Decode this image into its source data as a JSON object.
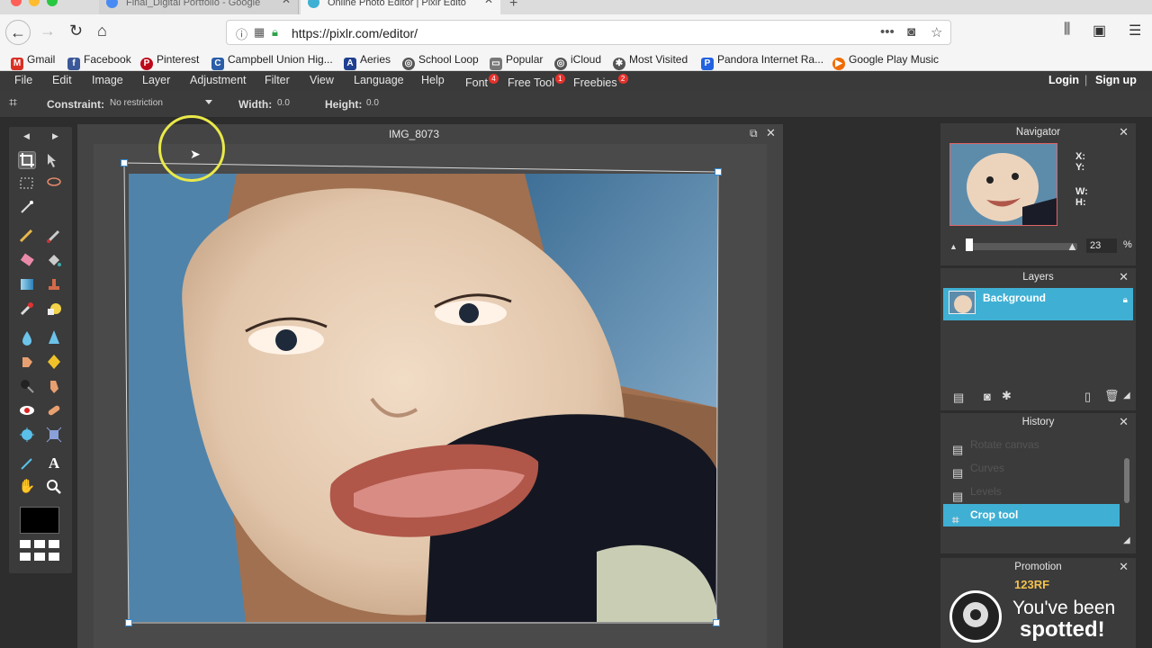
{
  "browser": {
    "tabs": [
      {
        "title": "Final_Digital Portfolio - Google"
      },
      {
        "title": "Online Photo Editor | Pixlr Edito"
      }
    ],
    "url": "https://pixlr.com/editor/",
    "bookmarks": [
      {
        "label": "Gmail",
        "icon": "gmail-icon",
        "color": "#d93025"
      },
      {
        "label": "Facebook",
        "icon": "facebook-icon",
        "color": "#3b5998"
      },
      {
        "label": "Pinterest",
        "icon": "pinterest-icon",
        "color": "#bd081c"
      },
      {
        "label": "Campbell Union Hig...",
        "icon": "school-icon",
        "color": "#2a5ea8"
      },
      {
        "label": "Aeries",
        "icon": "aeries-icon",
        "color": "#1f3f8f"
      },
      {
        "label": "School Loop",
        "icon": "globe-icon",
        "color": "#555"
      },
      {
        "label": "Popular",
        "icon": "folder-icon",
        "color": "#777"
      },
      {
        "label": "iCloud",
        "icon": "globe-icon",
        "color": "#555"
      },
      {
        "label": "Most Visited",
        "icon": "gear-icon",
        "color": "#555"
      },
      {
        "label": "Pandora Internet Ra...",
        "icon": "pandora-icon",
        "color": "#2262e0"
      },
      {
        "label": "Google Play Music",
        "icon": "play-music-icon",
        "color": "#ef6c00"
      }
    ]
  },
  "app": {
    "menu": [
      {
        "label": "File"
      },
      {
        "label": "Edit"
      },
      {
        "label": "Image"
      },
      {
        "label": "Layer"
      },
      {
        "label": "Adjustment"
      },
      {
        "label": "Filter"
      },
      {
        "label": "View"
      },
      {
        "label": "Language"
      },
      {
        "label": "Help"
      },
      {
        "label": "Font",
        "badge": "4"
      },
      {
        "label": "Free Tool",
        "badge": "1"
      },
      {
        "label": "Freebies",
        "badge": "2"
      }
    ],
    "login": "Login",
    "separator": "|",
    "signup": "Sign up"
  },
  "options": {
    "constraint_label": "Constraint:",
    "constraint_value": "No restriction",
    "width_label": "Width:",
    "width_value": "0.0",
    "height_label": "Height:",
    "height_value": "0.0"
  },
  "document": {
    "title": "IMG_8073"
  },
  "navigator": {
    "title": "Navigator",
    "x_label": "X:",
    "y_label": "Y:",
    "w_label": "W:",
    "h_label": "H:",
    "zoom": "23",
    "zoom_unit": "%"
  },
  "layers": {
    "title": "Layers",
    "items": [
      {
        "name": "Background"
      }
    ]
  },
  "history": {
    "title": "History",
    "items": [
      {
        "label": "Rotate canvas"
      },
      {
        "label": "Curves"
      },
      {
        "label": "Levels"
      },
      {
        "label": "Crop tool"
      }
    ]
  },
  "promotion": {
    "title": "Promotion",
    "brand": "123RF",
    "line1": "You've been",
    "line2": "spotted!"
  },
  "colors": {
    "accent": "#3fb0d4",
    "crop_handle": "#2b8de0",
    "cursor_ring": "#e9e94a"
  }
}
